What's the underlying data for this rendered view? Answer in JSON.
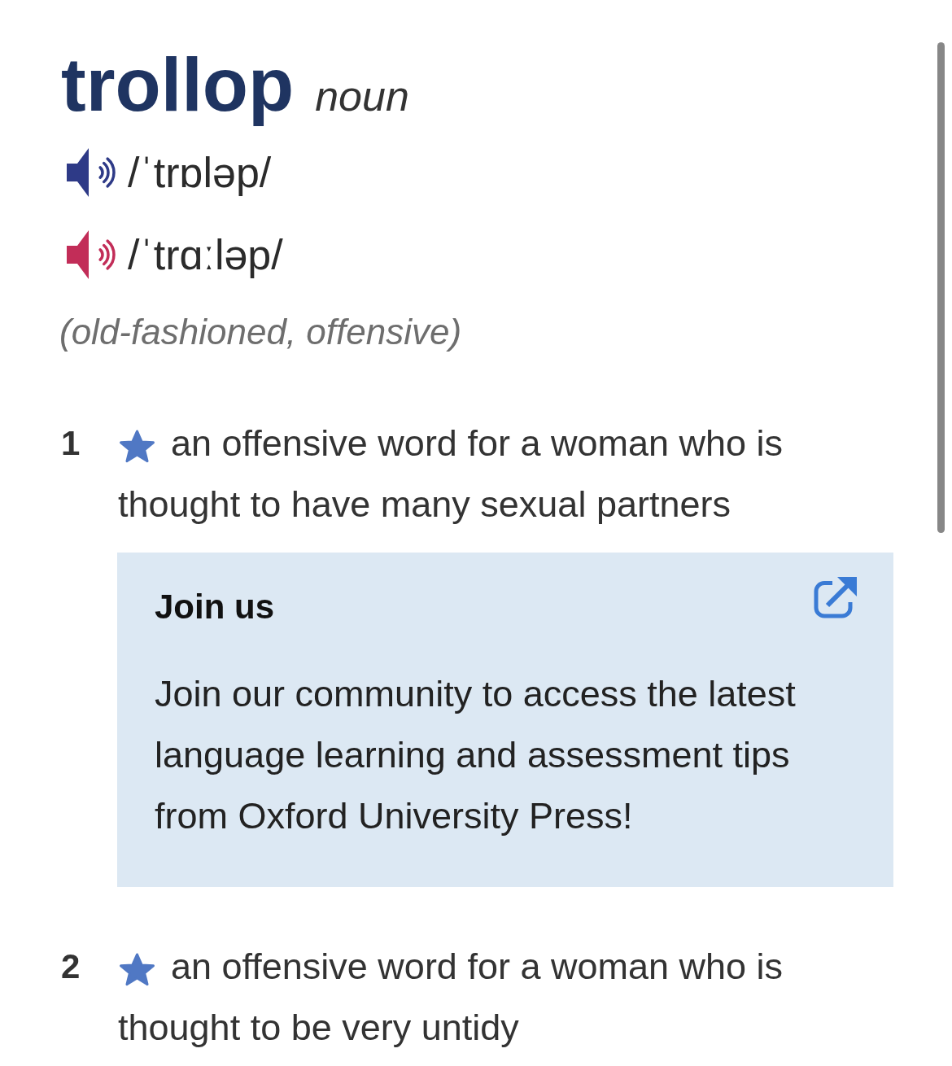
{
  "entry": {
    "headword": "trollop",
    "part_of_speech": "noun"
  },
  "pronunciations": [
    {
      "ipa": "/ˈtrɒləp/",
      "color": "#2e3a87"
    },
    {
      "ipa": "/ˈtrɑːləp/",
      "color": "#c22d58"
    }
  ],
  "labels": "(old-fashioned, offensive)",
  "blocks": [
    {
      "kind": "sense",
      "number": "1",
      "starred": true,
      "definition": "an offensive word for a woman who is thought to have many sexual partners"
    },
    {
      "kind": "promo",
      "title": "Join us",
      "text": "Join our community to access the latest language learning and assessment tips from Oxford University Press!"
    },
    {
      "kind": "sense",
      "number": "2",
      "starred": true,
      "definition": "an offensive word for a woman who is thought to be very untidy"
    }
  ]
}
